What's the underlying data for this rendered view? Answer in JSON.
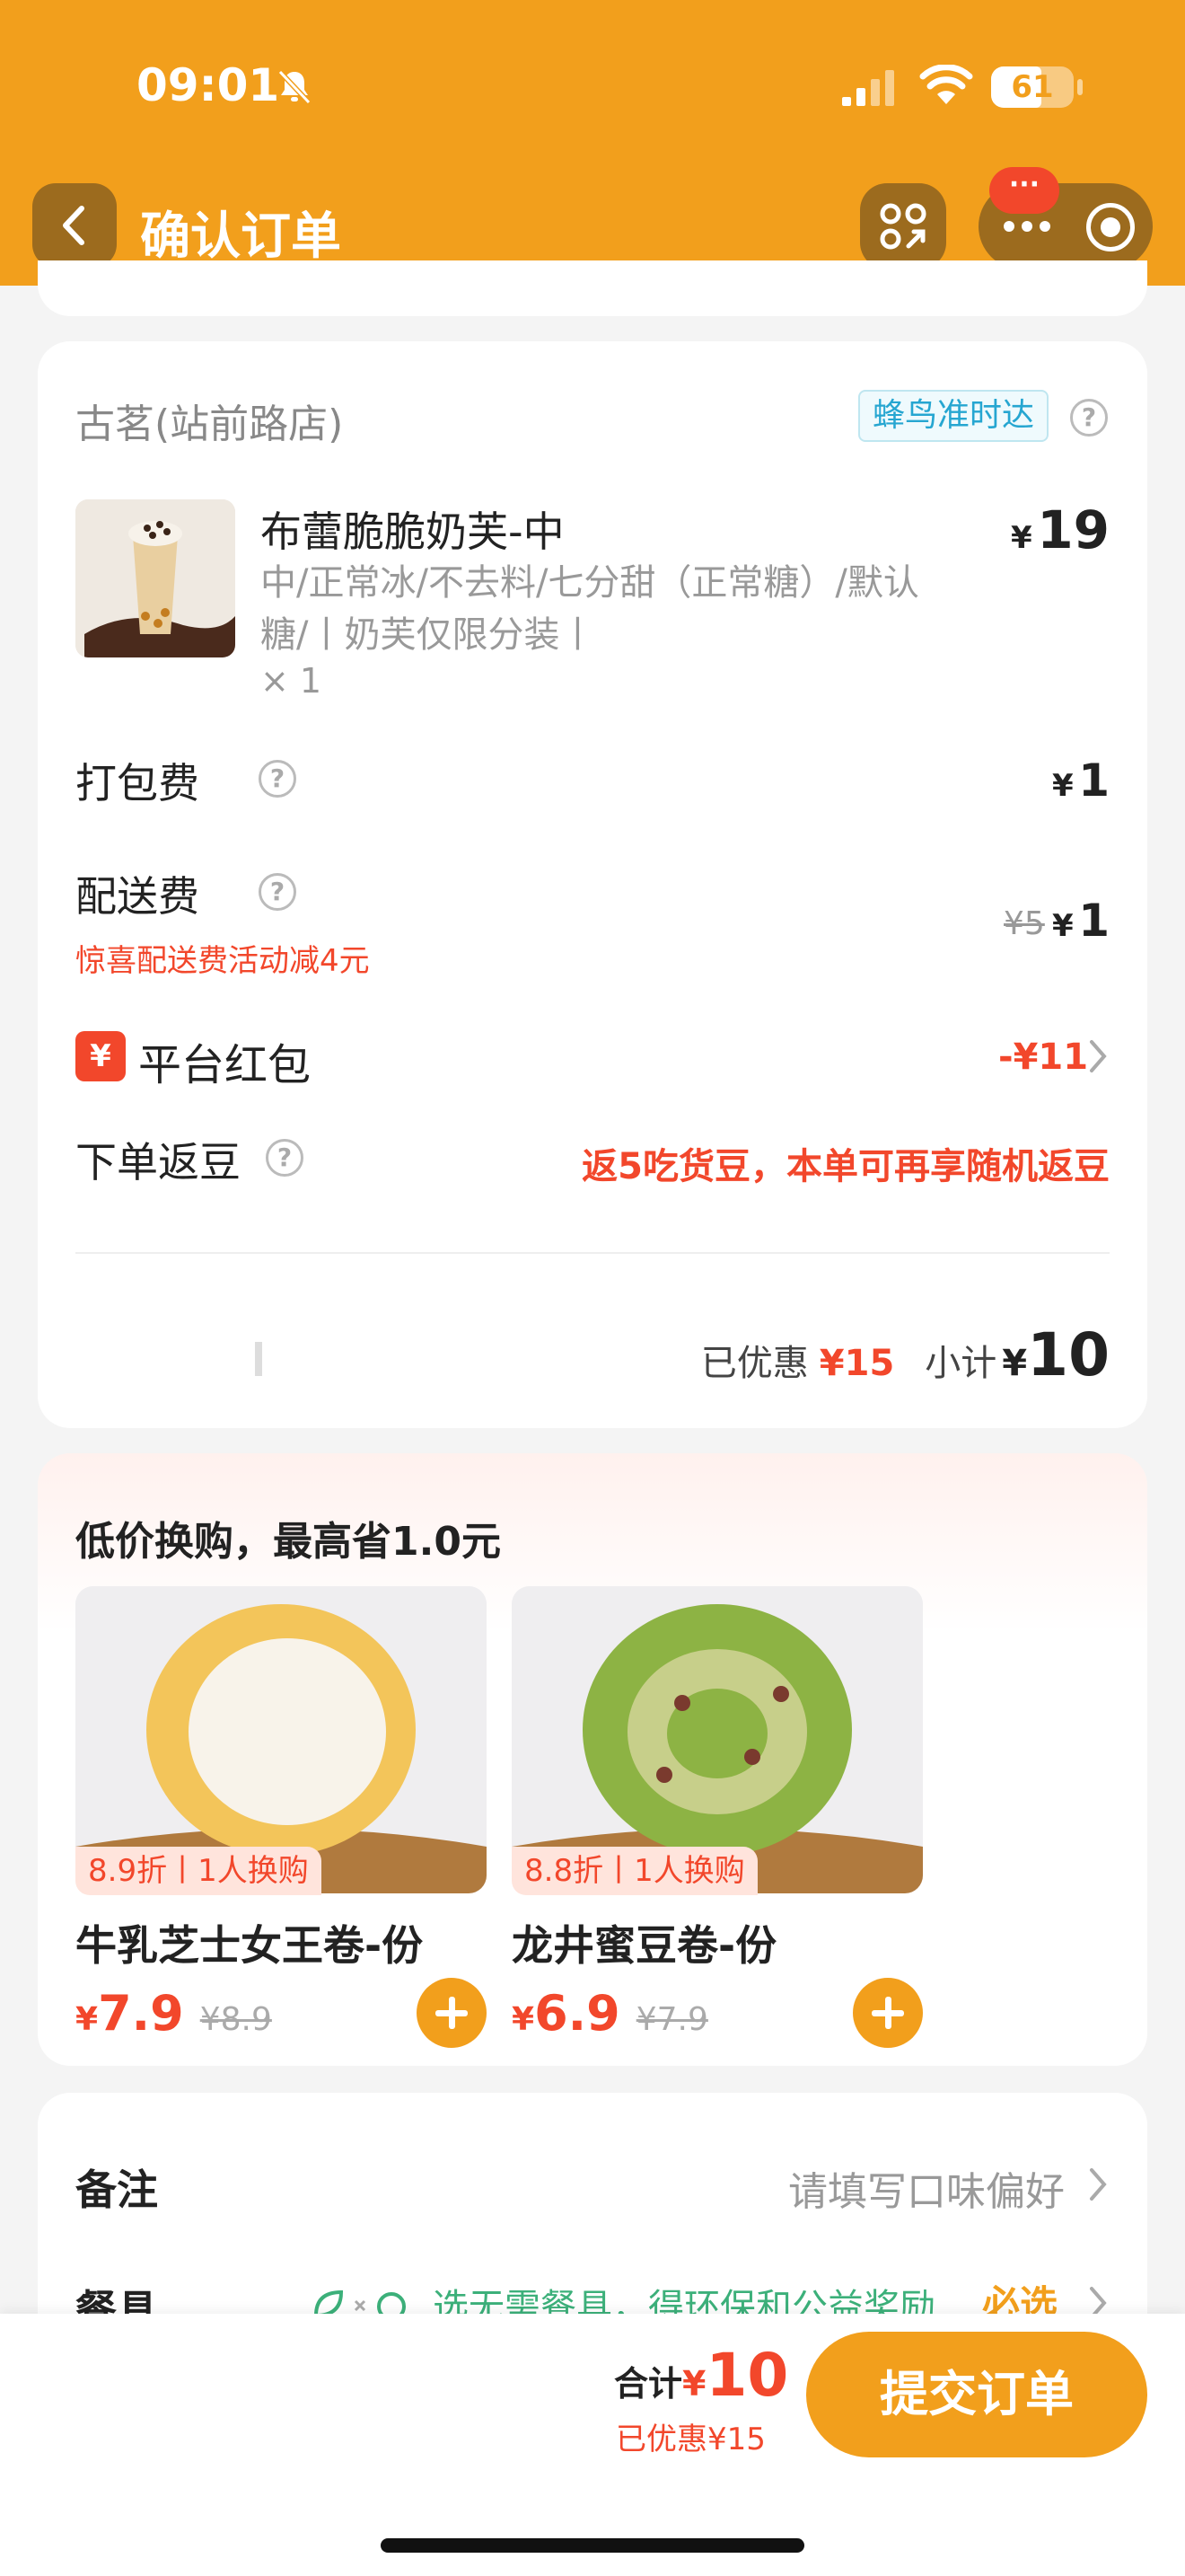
{
  "status_bar": {
    "time": "09:01",
    "battery": "61",
    "battery_level": 0.61
  },
  "header": {
    "title": "确认订单"
  },
  "order": {
    "shop_name": "古茗(站前路店)",
    "delivery_tag": "蜂鸟准时达",
    "product": {
      "name": "布蕾脆脆奶芙-中",
      "spec": "中/正常冰/不去料/七分甜（正常糖）/默认糖/丨奶芙仅限分装丨",
      "qty": "× 1",
      "currency": "¥",
      "price": "19"
    },
    "packing_fee": {
      "label": "打包费",
      "currency": "¥",
      "value": "1"
    },
    "delivery_fee": {
      "label": "配送费",
      "promo": "惊喜配送费活动减4元",
      "old": "¥5",
      "currency": "¥",
      "value": "1"
    },
    "red_packet": {
      "icon": "¥",
      "label": "平台红包",
      "value": "-¥11"
    },
    "beans": {
      "label": "下单返豆",
      "value": "返5吃货豆，本单可再享随机返豆"
    },
    "summary": {
      "discount_label": "已优惠",
      "discount_value": "¥15",
      "subtotal_label": "小计",
      "currency": "¥",
      "subtotal_value": "10"
    }
  },
  "swap": {
    "title": "低价换购，最高省1.0元",
    "items": [
      {
        "badge": "8.9折丨1人换购",
        "name": "牛乳芝士女王卷-份",
        "currency": "¥",
        "price": "7.9",
        "old": "¥8.9"
      },
      {
        "badge": "8.8折丨1人换购",
        "name": "龙井蜜豆卷-份",
        "currency": "¥",
        "price": "6.9",
        "old": "¥7.9"
      }
    ]
  },
  "notes": {
    "label": "备注",
    "placeholder": "请填写口味偏好",
    "tableware_label": "餐具",
    "tableware_text": "选无需餐具，得环保和公益奖励",
    "tableware_must": "必选"
  },
  "bottom": {
    "total_label": "合计",
    "currency": "¥",
    "total_value": "10",
    "discount": "已优惠¥15",
    "submit": "提交订单"
  },
  "colors": {
    "brand": "#F29F1C",
    "accent_red": "#F2472B",
    "eco_green": "#3CB07A"
  }
}
